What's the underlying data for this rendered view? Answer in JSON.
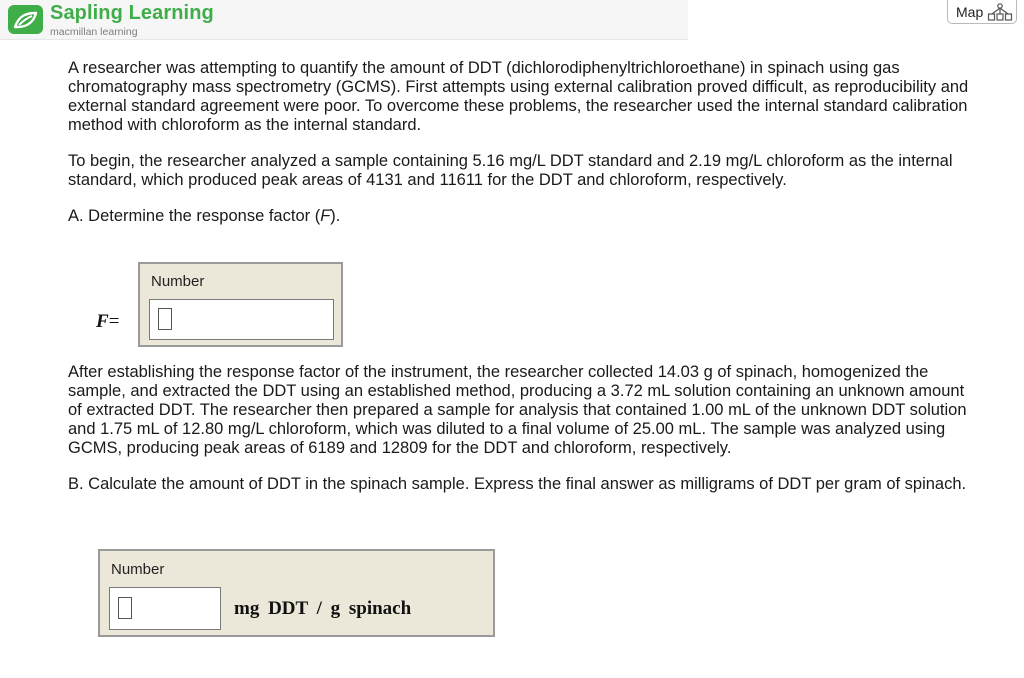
{
  "header": {
    "brand": "Sapling Learning",
    "subtitle": "macmillan learning",
    "map_label": "Map"
  },
  "problem": {
    "intro": "A researcher was attempting to quantify the amount of DDT (dichlorodiphenyltrichloroethane) in spinach using gas chromatography mass spectrometry (GCMS). First attempts using external calibration proved difficult, as reproducibility and external standard agreement were poor. To overcome these problems, the researcher used the internal standard calibration method with chloroform as the internal standard.",
    "setup": "To begin, the researcher analyzed a sample containing 5.16 mg/L DDT standard and 2.19 mg/L chloroform as the internal standard, which produced peak areas of 4131 and 11611 for the DDT and chloroform, respectively.",
    "part_a_prefix": "A. Determine the response factor (",
    "part_a_var": "F",
    "part_a_suffix": ").",
    "part_a_answer": {
      "number_label": "Number",
      "variable": "F",
      "equals": "=",
      "value": ""
    },
    "middle": "After establishing the response factor of the instrument, the researcher collected 14.03 g of spinach, homogenized the sample, and extracted the DDT using an established method, producing a 3.72 mL solution containing an unknown amount of extracted DDT. The researcher then prepared a sample for analysis that contained 1.00 mL of the unknown DDT solution and 1.75 mL of 12.80 mg/L chloroform, which was diluted to a final volume of 25.00 mL. The sample was analyzed using GCMS, producing peak areas of 6189 and 12809 for the DDT and chloroform, respectively.",
    "part_b": "B. Calculate the amount of DDT in the spinach sample. Express the final answer as milligrams of DDT per gram of spinach.",
    "part_b_answer": {
      "number_label": "Number",
      "unit": "mg DDT / g spinach",
      "value": ""
    }
  },
  "colors": {
    "brand_green": "#3fae49",
    "answer_box_bg": "#ebe7d9",
    "answer_box_border": "#9a9a9a"
  },
  "icons": [
    "sapling-leaf-icon",
    "map-tree-icon"
  ]
}
